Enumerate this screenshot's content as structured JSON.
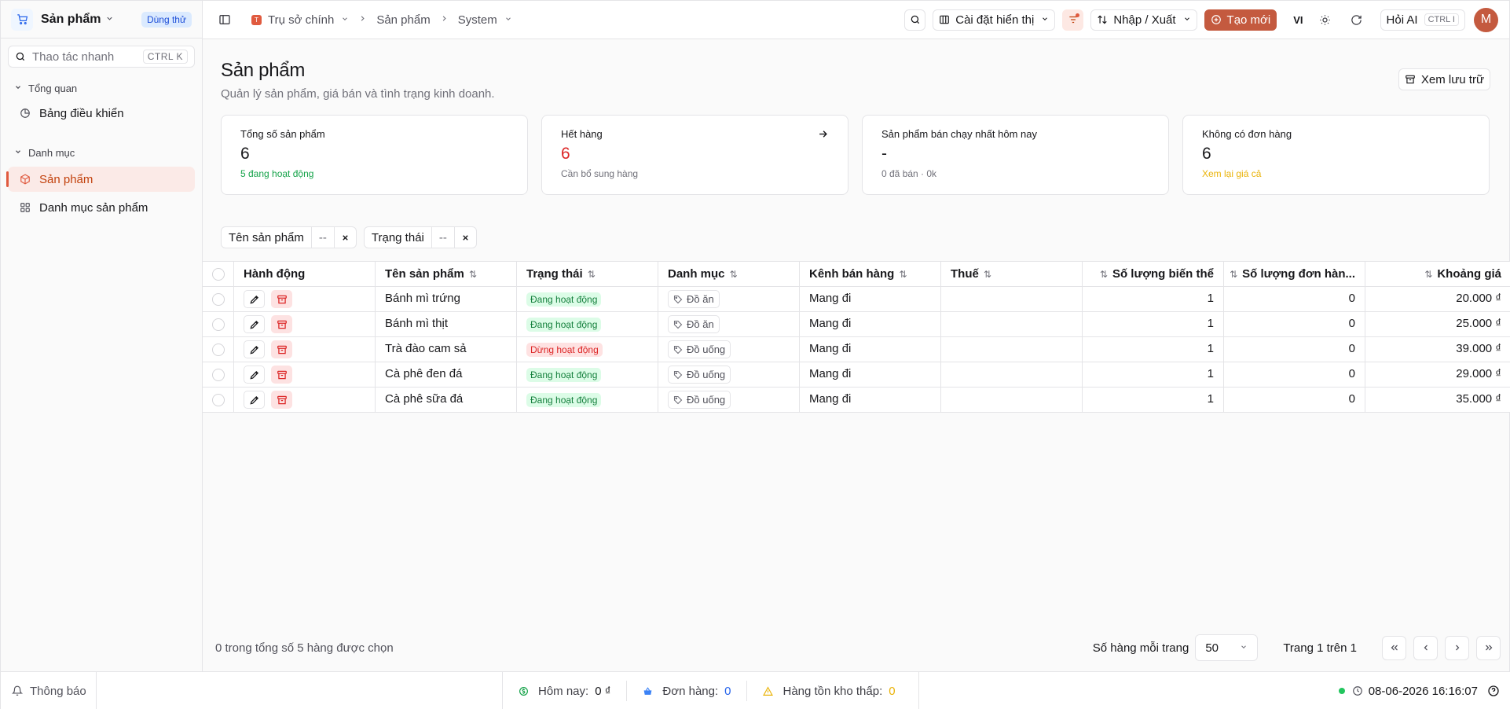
{
  "colors": {
    "accent": "#c45a3f",
    "success": "#16a34a",
    "danger": "#dc2626",
    "warning": "#eab308",
    "info": "#2563eb"
  },
  "sidebar": {
    "app_name": "Sản phẩm",
    "trial_badge": "Dùng thử",
    "search_placeholder": "Thao tác nhanh",
    "search_shortcut": "CTRL K",
    "groups": [
      {
        "label": "Tổng quan",
        "items": [
          {
            "label": "Bảng điều khiển",
            "icon": "dashboard-icon"
          }
        ]
      },
      {
        "label": "Danh mục",
        "items": [
          {
            "label": "Sản phẩm",
            "icon": "box-icon",
            "active": true
          },
          {
            "label": "Danh mục sản phẩm",
            "icon": "grid-icon"
          }
        ]
      }
    ]
  },
  "topbar": {
    "breadcrumb": {
      "org_initial": "T",
      "org": "Trụ sở chính",
      "section": "Sản phẩm",
      "sub": "System"
    },
    "display_settings": "Cài đặt hiển thị",
    "import_export": "Nhập / Xuất",
    "create_new": "Tạo mới",
    "language": "VI",
    "ask_ai": "Hỏi AI",
    "ask_ai_shortcut": "CTRL I",
    "avatar_initial": "M"
  },
  "page": {
    "title": "Sản phẩm",
    "subtitle": "Quản lý sản phẩm, giá bán và tình trạng kinh doanh.",
    "archive_button": "Xem lưu trữ"
  },
  "cards": [
    {
      "label": "Tổng số sản phẩm",
      "value": "6",
      "hint": "5 đang hoạt động",
      "hint_color": "#16a34a",
      "value_color": "#18181b"
    },
    {
      "label": "Hết hàng",
      "value": "6",
      "hint": "Cần bổ sung hàng",
      "hint_color": "#71717a",
      "value_color": "#dc2626"
    },
    {
      "label": "Sản phẩm bán chạy nhất hôm nay",
      "value": "-",
      "hint": "0 đã bán · 0k",
      "hint_color": "#71717a",
      "value_color": "#18181b"
    },
    {
      "label": "Không có đơn hàng",
      "value": "6",
      "hint": "Xem lại giá cả",
      "hint_color": "#eab308",
      "value_color": "#18181b"
    }
  ],
  "filters": [
    {
      "label": "Tên sản phẩm",
      "value": "--"
    },
    {
      "label": "Trạng thái",
      "value": "--"
    }
  ],
  "table": {
    "columns": [
      "Hành động",
      "Tên sản phẩm",
      "Trạng thái",
      "Danh mục",
      "Kênh bán hàng",
      "Thuế",
      "Số lượng biến thể",
      "Số lượng đơn hàn...",
      "Khoảng giá"
    ],
    "rows": [
      {
        "name": "Bánh mì trứng",
        "status": "Đang hoạt động",
        "active": true,
        "category": "Đồ ăn",
        "channel": "Mang đi",
        "tax": "",
        "variants": "1",
        "orders": "0",
        "price": "20.000 ₫"
      },
      {
        "name": "Bánh mì thịt",
        "status": "Đang hoạt động",
        "active": true,
        "category": "Đồ ăn",
        "channel": "Mang đi",
        "tax": "",
        "variants": "1",
        "orders": "0",
        "price": "25.000 ₫"
      },
      {
        "name": "Trà đào cam sả",
        "status": "Dừng hoạt động",
        "active": false,
        "category": "Đồ uống",
        "channel": "Mang đi",
        "tax": "",
        "variants": "1",
        "orders": "0",
        "price": "39.000 ₫"
      },
      {
        "name": "Cà phê đen đá",
        "status": "Đang hoạt động",
        "active": true,
        "category": "Đồ uống",
        "channel": "Mang đi",
        "tax": "",
        "variants": "1",
        "orders": "0",
        "price": "29.000 ₫"
      },
      {
        "name": "Cà phê sữa đá",
        "status": "Đang hoạt động",
        "active": true,
        "category": "Đồ uống",
        "channel": "Mang đi",
        "tax": "",
        "variants": "1",
        "orders": "0",
        "price": "35.000 ₫"
      }
    ]
  },
  "pager": {
    "selected_text": "0 trong tổng số 5 hàng được chọn",
    "rows_per_page_label": "Số hàng mỗi trang",
    "rows_per_page": "50",
    "page_text": "Trang 1 trên 1"
  },
  "footer": {
    "notifications": "Thông báo",
    "today_label": "Hôm nay:",
    "today_value": "0 ₫",
    "orders_label": "Đơn hàng:",
    "orders_value": "0",
    "low_stock_label": "Hàng tồn kho thấp:",
    "low_stock_value": "0",
    "datetime": "08-06-2026 16:16:07"
  }
}
